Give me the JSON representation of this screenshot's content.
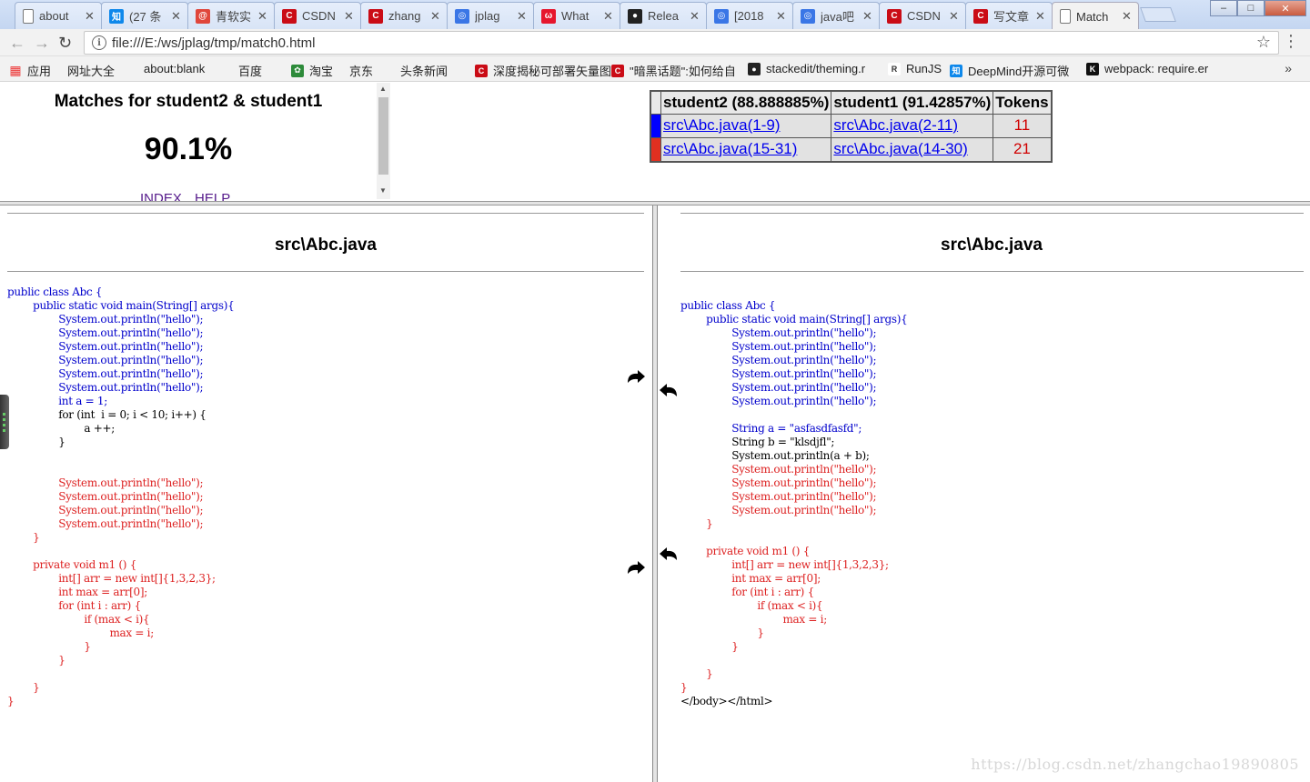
{
  "browser": {
    "tabs": [
      {
        "title": "about",
        "icon": "page-icon",
        "color": "#777777"
      },
      {
        "title": "(27 条",
        "icon": "zhihu-icon",
        "color": "#0e88eb"
      },
      {
        "title": "青软实",
        "icon": "at-icon",
        "color": "#e0463b"
      },
      {
        "title": "CSDN",
        "icon": "csdn-icon",
        "color": "#ca0c16"
      },
      {
        "title": "zhang",
        "icon": "csdn-icon",
        "color": "#ca0c16"
      },
      {
        "title": "jplag",
        "icon": "baidu-icon",
        "color": "#3a76e6"
      },
      {
        "title": "What",
        "icon": "weibo-icon",
        "color": "#e6162d"
      },
      {
        "title": "Relea",
        "icon": "github-icon",
        "color": "#222222"
      },
      {
        "title": "[2018",
        "icon": "baidu-icon",
        "color": "#3a76e6"
      },
      {
        "title": "java吧",
        "icon": "baidu-icon",
        "color": "#3a76e6"
      },
      {
        "title": "CSDN",
        "icon": "csdn-icon",
        "color": "#ca0c16"
      },
      {
        "title": "写文章",
        "icon": "csdn-icon",
        "color": "#ca0c16"
      },
      {
        "title": "Match",
        "icon": "page-icon",
        "color": "#777777",
        "active": true
      }
    ],
    "url": "file:///E:/ws/jplag/tmp/match0.html",
    "bookmarks": [
      {
        "label": "应用",
        "icon": "apps-grid-icon"
      },
      {
        "label": "网址大全",
        "icon": "page-icon"
      },
      {
        "label": "about:blank",
        "icon": "page-icon"
      },
      {
        "label": "百度",
        "icon": "page-icon"
      },
      {
        "label": "淘宝",
        "icon": "taobao-icon"
      },
      {
        "label": "京东",
        "icon": "page-icon"
      },
      {
        "label": "头条新闻",
        "icon": "page-icon"
      },
      {
        "label": "深度揭秘可部署矢量图",
        "icon": "csdn-icon"
      },
      {
        "label": "\"暗黑话题\":如何给自",
        "icon": "csdn-icon"
      },
      {
        "label": "stackedit/theming.r",
        "icon": "github-icon"
      },
      {
        "label": "RunJS",
        "icon": "runjs-icon"
      },
      {
        "label": "DeepMind开源可微",
        "icon": "zhihu-icon"
      },
      {
        "label": "webpack: require.er",
        "icon": "k-icon"
      }
    ],
    "more": "»"
  },
  "summary": {
    "title": "Matches for student2 & student1",
    "percent": "90.1%",
    "index_link": "INDEX",
    "help_link": "HELP"
  },
  "match_table": {
    "headers": [
      "student2 (88.888885%)",
      "student1 (91.42857%)",
      "Tokens"
    ],
    "rows": [
      {
        "color": "#0000ff",
        "left": "src\\Abc.java(1-9)",
        "right": "src\\Abc.java(2-11)",
        "tokens": "11"
      },
      {
        "color": "#e03020",
        "left": "src\\Abc.java(15-31)",
        "right": "src\\Abc.java(14-30)",
        "tokens": "21"
      }
    ]
  },
  "left_pane": {
    "filename": "src\\Abc.java",
    "code_blue": "public class Abc {\n\tpublic static void main(String[] args){\n\t\tSystem.out.println(\"hello\");\n\t\tSystem.out.println(\"hello\");\n\t\tSystem.out.println(\"hello\");\n\t\tSystem.out.println(\"hello\");\n\t\tSystem.out.println(\"hello\");\n\t\tSystem.out.println(\"hello\");\n\t\tint a = 1;",
    "code_black": "\t\tfor (int  i = 0; i < 10; i++) {\n\t\t\ta ++;\n\t\t}\n\n",
    "code_red": "\t\tSystem.out.println(\"hello\");\n\t\tSystem.out.println(\"hello\");\n\t\tSystem.out.println(\"hello\");\n\t\tSystem.out.println(\"hello\");\n\t}\n\n\tprivate void m1 () {\n\t\tint[] arr = new int[]{1,3,2,3};\n\t\tint max = arr[0];\n\t\tfor (int i : arr) {\n\t\t\tif (max < i){\n\t\t\t\tmax = i;\n\t\t\t}\n\t\t}\n\n\t}\n}"
  },
  "right_pane": {
    "filename": "src\\Abc.java",
    "code_blue": "public class Abc {\n\tpublic static void main(String[] args){\n\t\tSystem.out.println(\"hello\");\n\t\tSystem.out.println(\"hello\");\n\t\tSystem.out.println(\"hello\");\n\t\tSystem.out.println(\"hello\");\n\t\tSystem.out.println(\"hello\");\n\t\tSystem.out.println(\"hello\");\n\n\t\tString a = \"asfasdfasfd\";",
    "code_black": "\t\tString b = \"klsdjfl\";\n\t\tSystem.out.println(a + b);",
    "code_red": "\t\tSystem.out.println(\"hello\");\n\t\tSystem.out.println(\"hello\");\n\t\tSystem.out.println(\"hello\");\n\t\tSystem.out.println(\"hello\");\n\t}\n\n\tprivate void m1 () {\n\t\tint[] arr = new int[]{1,3,2,3};\n\t\tint max = arr[0];\n\t\tfor (int i : arr) {\n\t\t\tif (max < i){\n\t\t\t\tmax = i;\n\t\t\t}\n\t\t}\n\n\t}\n}",
    "code_tail": "</body></html>"
  },
  "watermark": "https://blog.csdn.net/zhangchao19890805"
}
